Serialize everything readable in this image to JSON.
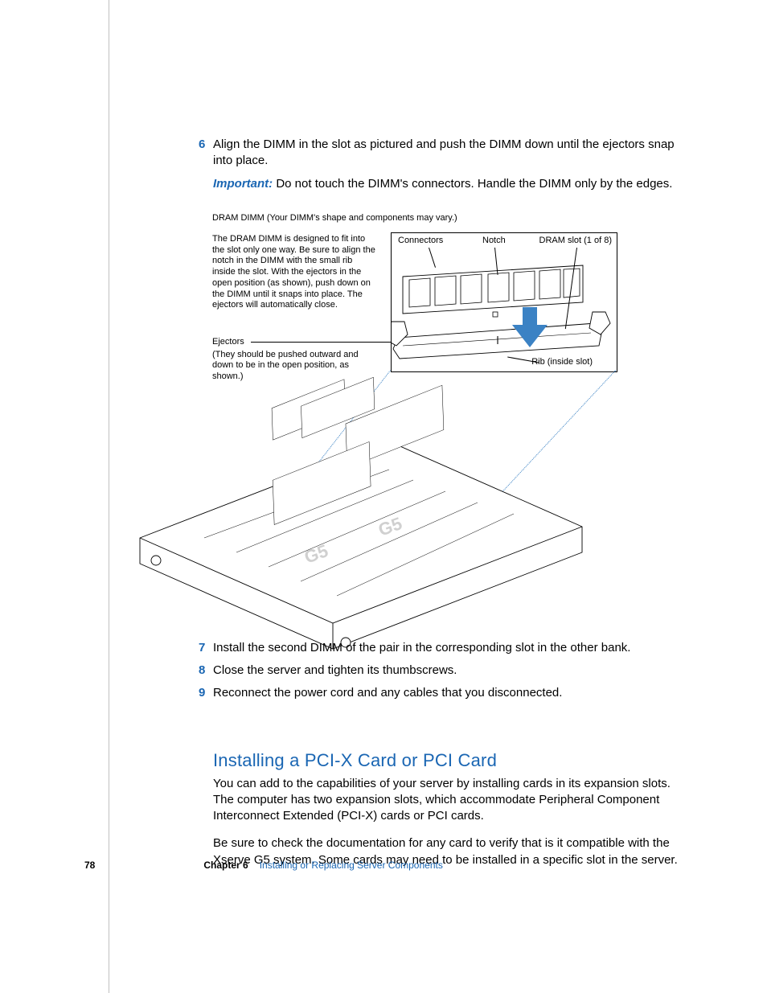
{
  "steps": {
    "s6_num": "6",
    "s6_text": "Align the DIMM in the slot as pictured and push the DIMM down until the ejectors snap into place.",
    "s6_important_label": "Important:",
    "s6_important_text": "  Do not touch the DIMM's connectors. Handle the DIMM only by the edges.",
    "s7_num": "7",
    "s7_text": "Install the second DIMM of the pair in the corresponding slot in the other bank.",
    "s8_num": "8",
    "s8_text": "Close the server and tighten its thumbscrews.",
    "s9_num": "9",
    "s9_text": "Reconnect the power cord and any cables that you disconnected."
  },
  "diagram": {
    "title": "DRAM DIMM (Your DIMM's shape and components may vary.)",
    "note": "The DRAM DIMM is designed to fit into the slot only one way. Be sure to align the notch in the DIMM with the small rib inside the slot. With the ejectors in the open position (as shown), push down on the DIMM until it snaps into place. The ejectors will automatically close.",
    "ejectors_label": "Ejectors",
    "ejectors_text": "(They should be pushed outward and down to be in the open position, as shown.)",
    "label_connectors": "Connectors",
    "label_notch": "Notch",
    "label_dram_slot": "DRAM slot (1 of 8)",
    "label_rib": "Rib (inside slot)"
  },
  "section": {
    "heading": "Installing a PCI-X Card or PCI Card",
    "p1": "You can add to the capabilities of your server by installing cards in its expansion slots. The computer has two expansion slots, which accommodate Peripheral Component Interconnect Extended (PCI-X) cards or PCI cards.",
    "p2": "Be sure to check the documentation for any card to verify that is it compatible with the Xserve G5 system. Some cards may need to be installed in a specific slot in the server."
  },
  "footer": {
    "page_number": "78",
    "chapter_num": "Chapter 6",
    "chapter_title": "Installing or Replacing Server Components"
  }
}
